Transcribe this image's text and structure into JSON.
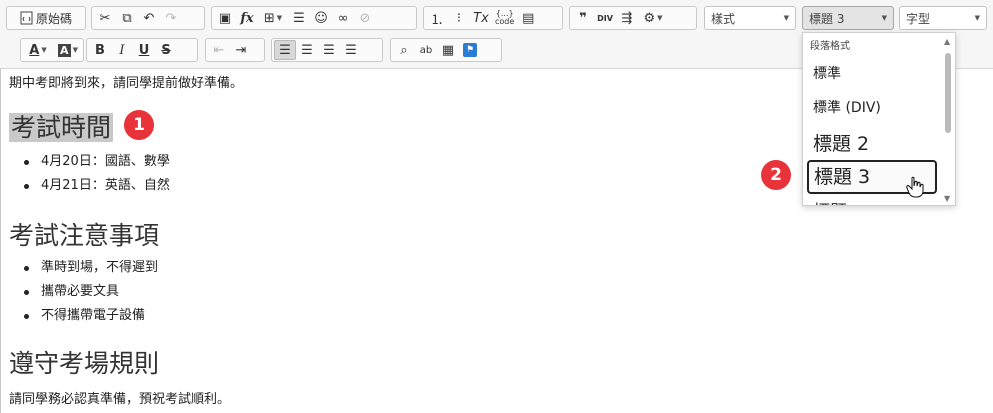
{
  "toolbar": {
    "source_label": "原始碼",
    "styles_label": "樣式",
    "format_label": "標題 3",
    "font_label": "字型",
    "icons": [
      "source-icon",
      "cut-icon",
      "copy-icon",
      "undo-icon",
      "redo-icon",
      "image-icon",
      "formula-icon",
      "table-icon",
      "horizontal-rule-icon",
      "smiley-icon",
      "link-icon",
      "unlink-icon",
      "numbered-list-icon",
      "bulleted-list-icon",
      "remove-format-icon",
      "code-snippet-icon",
      "show-blocks-icon",
      "blockquote-icon",
      "div-container-icon",
      "sort-icon",
      "settings-icon",
      "text-color-icon",
      "background-color-icon",
      "bold-icon",
      "italic-icon",
      "underline-icon",
      "strikethrough-icon",
      "decrease-indent-icon",
      "increase-indent-icon",
      "align-left-icon",
      "align-center-icon",
      "align-right-icon",
      "justify-icon",
      "find-icon",
      "replace-icon",
      "paste-icon",
      "flag-icon"
    ],
    "code_label": "{...}\ncode",
    "div_label": "DIV"
  },
  "content": {
    "intro": "期中考即將到來，請同學提前做好準備。",
    "heading1": "考試時間",
    "list1": [
      "4月20日：國語、數學",
      "4月21日：英語、自然"
    ],
    "heading2": "考試注意事項",
    "list2": [
      "準時到場，不得遲到",
      "攜帶必要文具",
      "不得攜帶電子設備"
    ],
    "heading3": "遵守考場規則",
    "outro": "請同學務必認真準備，預祝考試順利。"
  },
  "dropdown": {
    "header": "段落格式",
    "options": [
      {
        "label": "標準"
      },
      {
        "label": "標準 (DIV)"
      },
      {
        "label": "標題 2"
      },
      {
        "label": "標題 3",
        "selected": true
      },
      {
        "label": "標題"
      }
    ]
  },
  "steps": {
    "one": "1",
    "two": "2"
  },
  "colors": {
    "step_marker": "#e8333a",
    "flag_button": "#2b7cd3",
    "selection_highlight": "#c9c9c9"
  }
}
